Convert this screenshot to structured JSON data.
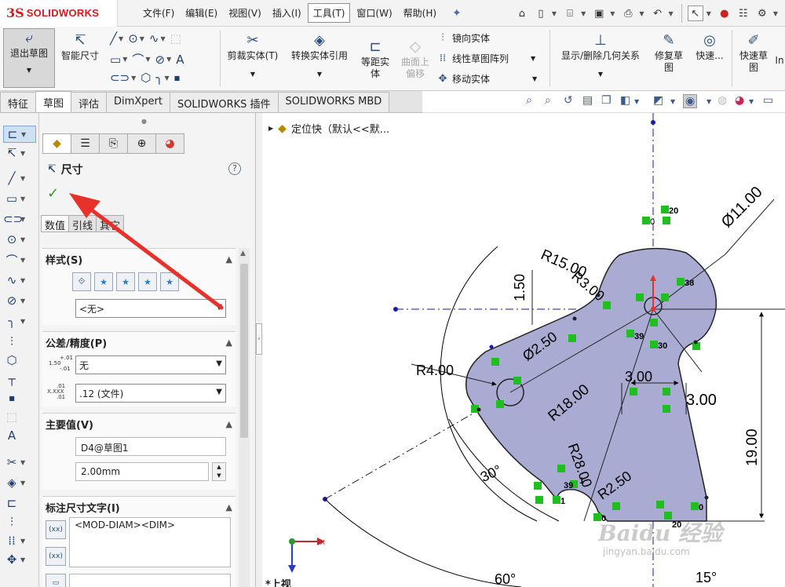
{
  "app": {
    "logo_mark": "3S",
    "logo_text": "SOLIDWORKS",
    "menu": [
      "文件(F)",
      "编辑(E)",
      "视图(V)",
      "插入(I)",
      "工具(T)",
      "窗口(W)",
      "帮助(H)"
    ],
    "active_menu_index": 4
  },
  "ribbon": {
    "exit_sketch": "退出草图",
    "smart_dim": "智能尺寸",
    "trim": "剪裁实体(T)",
    "convert": "转换实体引用",
    "offset_1": "等距实",
    "offset_2": "体",
    "surface_offset_1": "曲面上",
    "surface_offset_2": "偏移",
    "mirror": "镜向实体",
    "linear_pattern": "线性草图阵列",
    "move": "移动实体",
    "relations": "显示/删除几何关系",
    "repair_1": "修复草",
    "repair_2": "图",
    "quick_snaps": "快速...",
    "rapid_1": "快速草",
    "rapid_2": "图",
    "overflow": "In"
  },
  "tabs": [
    "特征",
    "草图",
    "评估",
    "DimXpert",
    "SOLIDWORKS 插件",
    "SOLIDWORKS MBD"
  ],
  "active_tab_index": 1,
  "property_manager": {
    "title": "尺寸",
    "help": "?",
    "ok": "✓",
    "subtabs": [
      "数值",
      "引线",
      "其它"
    ],
    "style": {
      "header": "样式(S)",
      "favorite": "<无>"
    },
    "tolerance": {
      "header": "公差/精度(P)",
      "type": "无",
      "precision": ".12 (文件)",
      "icon_top": "+.01",
      "icon_mid": "1.50",
      "icon_bot": "-.01",
      "icon2_top": ".01",
      "icon2_mid": "X.XXX",
      "icon2_bot": ".01"
    },
    "primary": {
      "header": "主要值(V)",
      "name": "D4@草图1",
      "value": "2.00mm"
    },
    "dim_text": {
      "header": "标注尺寸文字(I)",
      "text": "<MOD-DIAM><DIM>",
      "btn1": "(xx)",
      "btn2": "(xx)"
    }
  },
  "canvas": {
    "tree_node": "定位快（默认<<默...",
    "view_label": "*上视",
    "dims": [
      "Ø11.00",
      "R15.00",
      "1.50",
      "R3.00",
      "Ø2.50",
      "R4.00",
      "R18.00",
      "3.00",
      "3.00",
      "19.00",
      "R28.00",
      "R2.50",
      "30°",
      "60°",
      "15°"
    ],
    "relation_labels": [
      "20",
      "0",
      "38",
      "39",
      "30",
      "1",
      "39",
      "1",
      "0",
      "0",
      "20"
    ],
    "watermark": "Baidu 经验",
    "watermark_url": "jingyan.baidu.com"
  },
  "colors": {
    "sketch_fill": "#a9abd2",
    "accent_red": "#e8312a",
    "relation_green": "#1fbf1f",
    "axis_blue": "#1a1aaa"
  }
}
